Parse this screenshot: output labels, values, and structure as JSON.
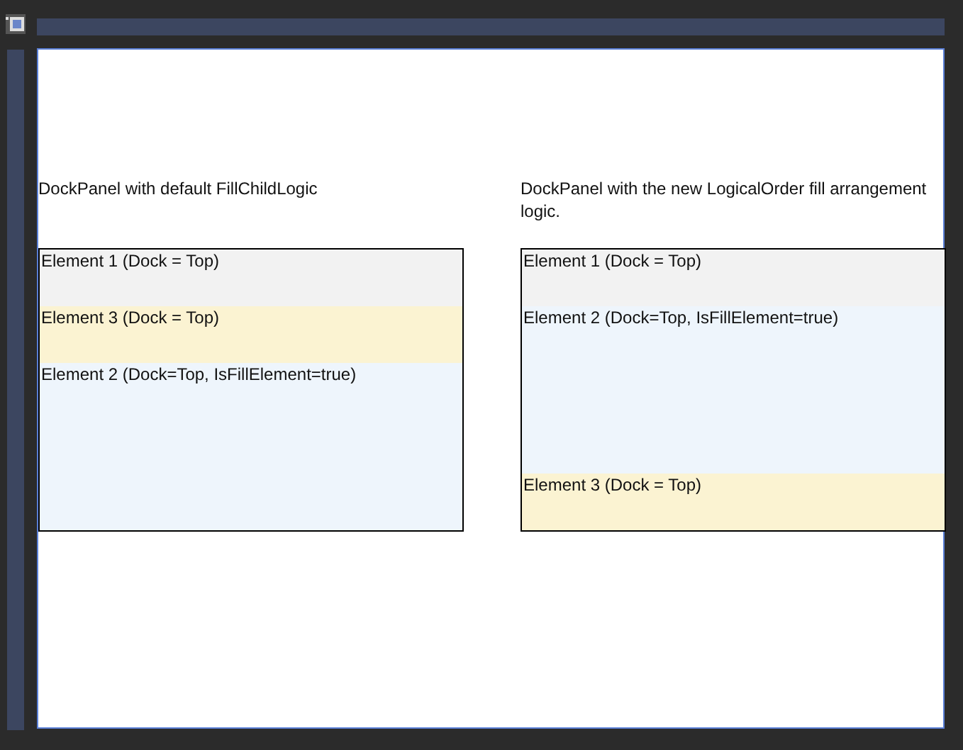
{
  "panels": [
    {
      "caption": "DockPanel with default FillChildLogic",
      "elements": [
        {
          "label": "Element 1 (Dock = Top)",
          "kind": "top",
          "color": "#f2f2f2"
        },
        {
          "label": "Element 3 (Dock = Top)",
          "kind": "top",
          "color": "#fbf3d2"
        },
        {
          "label": "Element 2 (Dock=Top, IsFillElement=true)",
          "kind": "fill",
          "color": "#eef5fc"
        }
      ]
    },
    {
      "caption": "DockPanel with the new LogicalOrder fill arrangement logic.",
      "elements": [
        {
          "label": "Element 1 (Dock = Top)",
          "kind": "top",
          "color": "#f2f2f2"
        },
        {
          "label": "Element 2 (Dock=Top, IsFillElement=true)",
          "kind": "fill",
          "color": "#eef5fc"
        },
        {
          "label": "Element 3 (Dock = Top)",
          "kind": "top",
          "color": "#fbf3d2"
        }
      ]
    }
  ]
}
